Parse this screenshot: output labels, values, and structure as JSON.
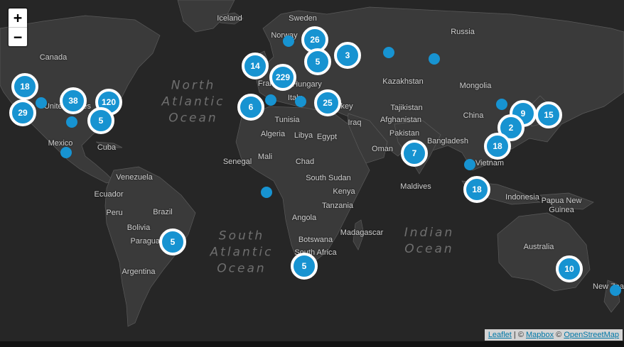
{
  "zoom": {
    "in_label": "+",
    "out_label": "−"
  },
  "attribution": {
    "leaflet": "Leaflet",
    "sep1": " | © ",
    "mapbox": "Mapbox",
    "sep2": " © ",
    "osm": "OpenStreetMap"
  },
  "oceans": [
    {
      "id": "north-atlantic",
      "text": "North\nAtlantic\nOcean"
    },
    {
      "id": "south-atlantic",
      "text": "South\nAtlantic\nOcean"
    },
    {
      "id": "indian",
      "text": "Indian\nOcean"
    }
  ],
  "labels": [
    "Iceland",
    "Sweden",
    "Norway",
    "Russia",
    "Canada",
    "United States",
    "Mexico",
    "Cuba",
    "Venezuela",
    "Ecuador",
    "Peru",
    "Bolivia",
    "Brazil",
    "Paraguay",
    "Argentina",
    "France",
    "Italy",
    "Hungary",
    "Turkey",
    "Tunisia",
    "Algeria",
    "Libya",
    "Egypt",
    "Iraq",
    "Kazakhstan",
    "Mongolia",
    "China",
    "Tajikistan",
    "Afghanistan",
    "Pakistan",
    "Oman",
    "Bangladesh",
    "Vietnam",
    "Indonesia",
    "Maldives",
    "Senegal",
    "Mali",
    "Chad",
    "South Sudan",
    "Kenya",
    "Tanzania",
    "Angola",
    "Botswana",
    "South Africa",
    "Madagascar",
    "Papua New Guinea",
    "Australia",
    "New Zealand"
  ],
  "clusters": [
    "26",
    "5",
    "3",
    "14",
    "229",
    "6",
    "25",
    "18",
    "29",
    "38",
    "120",
    "5",
    "9",
    "15",
    "2",
    "18",
    "7",
    "18",
    "5",
    "5",
    "10"
  ],
  "marker_color": "#1793d1"
}
